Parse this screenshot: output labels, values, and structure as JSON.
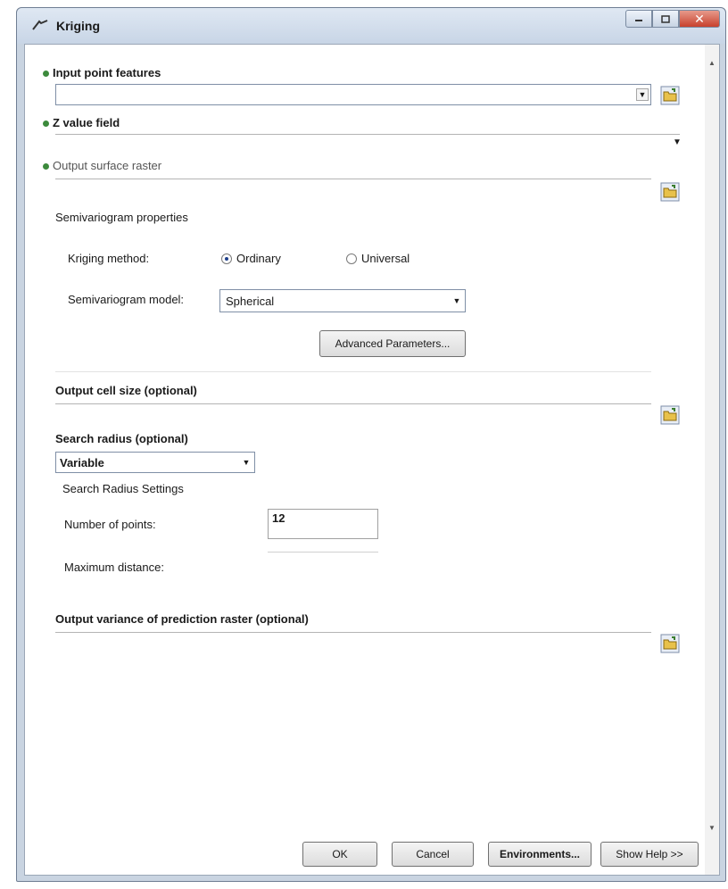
{
  "window": {
    "title": "Kriging"
  },
  "fields": {
    "input_point_features": {
      "label": "Input point features",
      "value": ""
    },
    "z_value_field": {
      "label": "Z value field"
    },
    "output_surface_raster": {
      "label": "Output surface raster"
    }
  },
  "semivariogram": {
    "section_label": "Semivariogram properties",
    "method_label": "Kriging method:",
    "options": [
      "Ordinary",
      "Universal"
    ],
    "selected": "Ordinary",
    "model_label": "Semivariogram model:",
    "model_value": "Spherical",
    "advanced_button": "Advanced Parameters..."
  },
  "output_cell_size": {
    "label": "Output cell size (optional)"
  },
  "search_radius": {
    "label": "Search radius (optional)",
    "value": "Variable",
    "settings_label": "Search Radius Settings",
    "num_points_label": "Number of points:",
    "num_points_value": "12",
    "max_distance_label": "Maximum distance:"
  },
  "output_variance": {
    "label": "Output variance of prediction raster (optional)"
  },
  "buttons": {
    "ok": "OK",
    "cancel": "Cancel",
    "environments": "Environments...",
    "show_help": "Show Help >>"
  },
  "icons": [
    "window-icon",
    "minimize-icon",
    "maximize-icon",
    "close-icon",
    "folder-icon",
    "dropdown-arrow-icon",
    "scroll-up-icon",
    "scroll-down-icon"
  ]
}
